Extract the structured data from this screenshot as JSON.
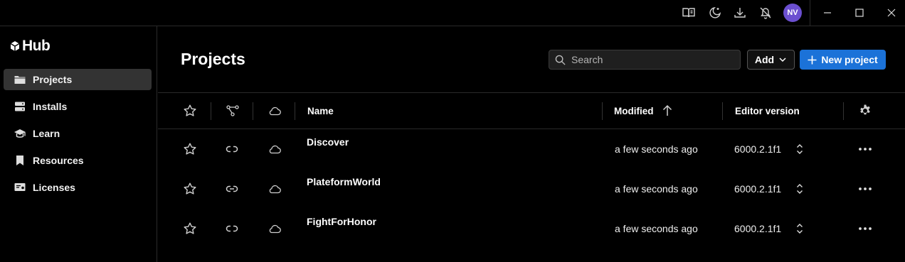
{
  "titlebar": {
    "avatar_initials": "NV",
    "icons": [
      "book-icon",
      "moon-icon",
      "download-icon",
      "bell-off-icon"
    ],
    "window_controls": [
      "minimize",
      "maximize",
      "close"
    ]
  },
  "sidebar": {
    "logo_text": "Hub",
    "items": [
      {
        "label": "Projects",
        "icon": "folder-icon",
        "active": true
      },
      {
        "label": "Installs",
        "icon": "server-icon",
        "active": false
      },
      {
        "label": "Learn",
        "icon": "graduation-cap-icon",
        "active": false
      },
      {
        "label": "Resources",
        "icon": "bookmark-icon",
        "active": false
      },
      {
        "label": "Licenses",
        "icon": "license-icon",
        "active": false
      }
    ]
  },
  "main": {
    "title": "Projects",
    "search_placeholder": "Search",
    "add_label": "Add",
    "new_project_label": "New project",
    "accent_color": "#1b72d8"
  },
  "table": {
    "headers": {
      "name": "Name",
      "modified": "Modified",
      "editor_version": "Editor version"
    },
    "sort": {
      "column": "modified",
      "direction": "ascending"
    },
    "rows": [
      {
        "name": "Discover",
        "modified": "a few seconds ago",
        "version": "6000.2.1f1"
      },
      {
        "name": "PlateformWorld",
        "modified": "a few seconds ago",
        "version": "6000.2.1f1"
      },
      {
        "name": "FightForHonor",
        "modified": "a few seconds ago",
        "version": "6000.2.1f1"
      }
    ]
  }
}
